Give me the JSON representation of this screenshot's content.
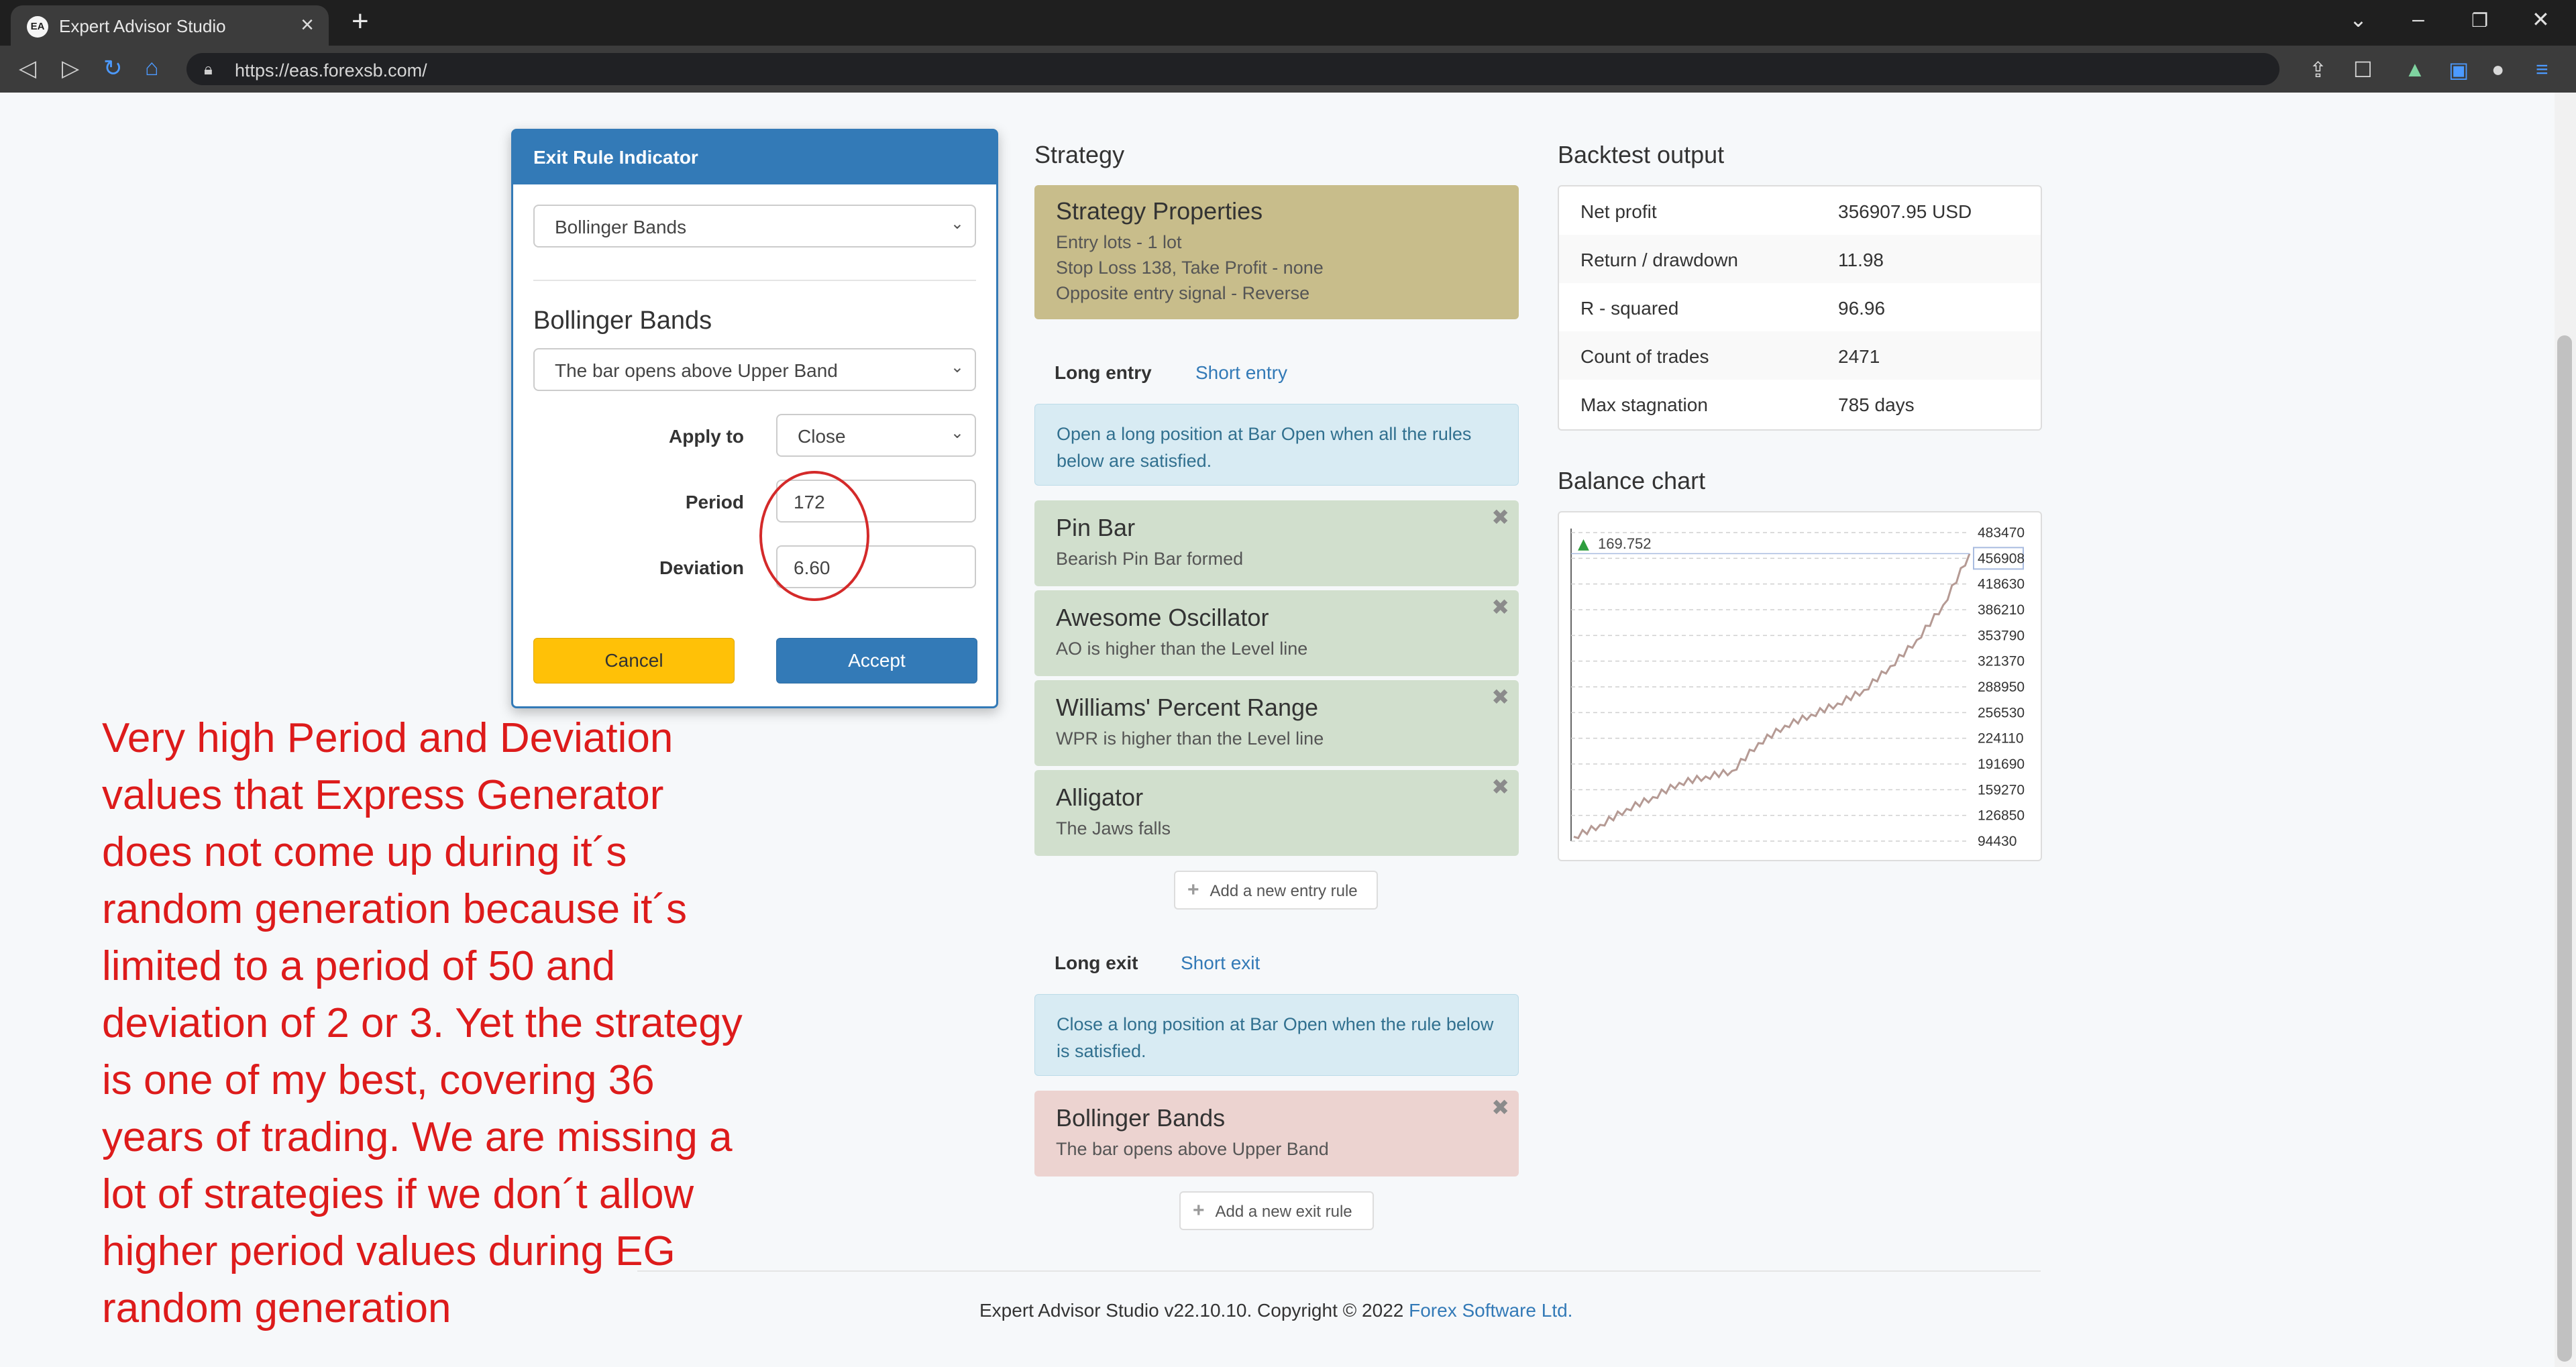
{
  "browser": {
    "tab_title": "Expert Advisor Studio",
    "tab_favicon_text": "EA",
    "url": "https://eas.forexsb.com/"
  },
  "modal": {
    "title": "Exit Rule Indicator",
    "indicator_select": "Bollinger Bands",
    "indicator_name": "Bollinger Bands",
    "rule_select": "The bar opens above Upper Band",
    "apply_to_label": "Apply to",
    "apply_to_value": "Close",
    "period_label": "Period",
    "period_value": "172",
    "deviation_label": "Deviation",
    "deviation_value": "6.60",
    "cancel_label": "Cancel",
    "accept_label": "Accept"
  },
  "annotation": "Very high Period and Deviation values that Express Generator does not come up during it´s random generation because it´s limited to a period of 50 and deviation of 2 or 3. Yet the strategy is one of my best, covering 36 years of trading. We are missing a lot of strategies if we don´t allow higher period values during EG random generation",
  "strategy": {
    "title": "Strategy",
    "properties": {
      "title": "Strategy Properties",
      "lines": [
        "Entry lots - 1 lot",
        "Stop Loss 138, Take Profit - none",
        "Opposite entry signal - Reverse"
      ]
    },
    "entry_tabs": [
      "Long entry",
      "Short entry"
    ],
    "entry_info": "Open a long position at Bar Open when all the rules below are satisfied.",
    "entry_rules": [
      {
        "name": "Pin Bar",
        "desc": "Bearish Pin Bar formed"
      },
      {
        "name": "Awesome Oscillator",
        "desc": "AO is higher than the Level line"
      },
      {
        "name": "Williams' Percent Range",
        "desc": "WPR is higher than the Level line"
      },
      {
        "name": "Alligator",
        "desc": "The Jaws falls"
      }
    ],
    "add_entry_label": "Add a new entry rule",
    "exit_tabs": [
      "Long exit",
      "Short exit"
    ],
    "exit_info": "Close a long position at Bar Open when the rule below is satisfied.",
    "exit_rules": [
      {
        "name": "Bollinger Bands",
        "desc": "The bar opens above Upper Band"
      }
    ],
    "add_exit_label": "Add a new exit rule",
    "close_symbol": "✖"
  },
  "backtest": {
    "title": "Backtest output",
    "rows": [
      {
        "label": "Net profit",
        "value": "356907.95 USD"
      },
      {
        "label": "Return / drawdown",
        "value": "11.98"
      },
      {
        "label": "R - squared",
        "value": "96.96"
      },
      {
        "label": "Count of trades",
        "value": "2471"
      },
      {
        "label": "Max stagnation",
        "value": "785 days"
      }
    ]
  },
  "balance_chart": {
    "title": "Balance chart",
    "stat_label": "169.752",
    "current_value_label": "456908"
  },
  "chart_data": {
    "type": "line",
    "title": "Balance chart",
    "ylim": [
      94430,
      483470
    ],
    "y_ticks": [
      483470,
      451050,
      418630,
      386210,
      353790,
      321370,
      288950,
      256530,
      224110,
      191690,
      159270,
      126850,
      94430
    ],
    "y_tick_labels": [
      "483470",
      "456908",
      "418630",
      "386210",
      "353790",
      "321370",
      "288950",
      "256530",
      "224110",
      "191690",
      "159270",
      "126850",
      "94430"
    ],
    "grid": true,
    "line_color": "#b59a94",
    "series": [
      {
        "x": [
          0,
          8,
          16,
          24,
          32,
          40,
          48,
          56,
          64,
          72,
          80,
          88,
          96,
          104,
          112,
          120
        ],
        "values": [
          100000,
          115000,
          135000,
          150000,
          168000,
          176000,
          183000,
          218000,
          240000,
          254000,
          268000,
          285000,
          315000,
          348000,
          392000,
          456908
        ]
      }
    ]
  },
  "footer": {
    "text": "Expert Advisor Studio v22.10.10. Copyright © 2022 ",
    "link": "Forex Software Ltd."
  }
}
